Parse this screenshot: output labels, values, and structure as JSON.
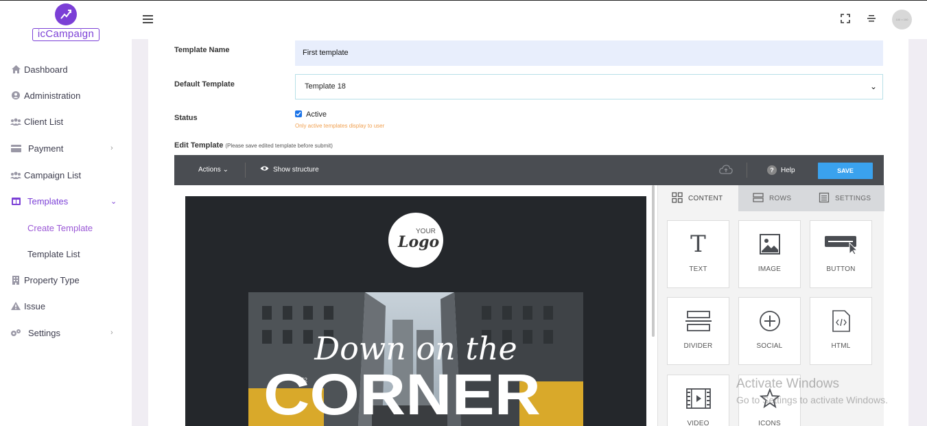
{
  "app": {
    "logo_text": "icCampaign"
  },
  "sidebar": {
    "items": [
      {
        "label": "Dashboard",
        "icon": "home-icon"
      },
      {
        "label": "Administration",
        "icon": "user-circle-icon"
      },
      {
        "label": "Client List",
        "icon": "users-icon"
      },
      {
        "label": "Payment",
        "icon": "card-icon",
        "chevron": "›"
      },
      {
        "label": "Campaign List",
        "icon": "users-icon"
      },
      {
        "label": "Templates",
        "icon": "columns-icon",
        "chevron": "⌄"
      },
      {
        "label": "Property Type",
        "icon": "building-icon"
      },
      {
        "label": "Issue",
        "icon": "warning-icon"
      },
      {
        "label": "Settings",
        "icon": "gears-icon",
        "chevron": "›"
      }
    ],
    "sub_items": [
      {
        "label": "Create Template"
      },
      {
        "label": "Template List"
      }
    ]
  },
  "header": {
    "avatar_text": "100 × 100"
  },
  "form": {
    "template_name_label": "Template Name",
    "template_name_value": "First template",
    "default_template_label": "Default Template",
    "default_template_value": "Template 18",
    "status_label": "Status",
    "active_label": "Active",
    "active_hint": "Only active templates display to user",
    "edit_template_label": "Edit Template",
    "edit_template_note": "(Please save edited template before submit)"
  },
  "editor": {
    "actions_label": "Actions",
    "show_structure_label": "Show structure",
    "help_label": "Help",
    "save_label": "SAVE",
    "tabs": [
      {
        "label": "CONTENT"
      },
      {
        "label": "ROWS"
      },
      {
        "label": "SETTINGS"
      }
    ],
    "blocks": [
      {
        "label": "TEXT"
      },
      {
        "label": "IMAGE"
      },
      {
        "label": "BUTTON"
      },
      {
        "label": "DIVIDER"
      },
      {
        "label": "SOCIAL"
      },
      {
        "label": "HTML"
      },
      {
        "label": "VIDEO"
      },
      {
        "label": "ICONS"
      }
    ],
    "email": {
      "logo_your": "YOUR",
      "logo_logo": "Logo",
      "hero_script": "Down on the",
      "hero_title": "CORNER",
      "taxi_text": "K72"
    }
  },
  "watermark": {
    "line1": "Activate Windows",
    "line2": "Go to Settings to activate Windows."
  },
  "colors": {
    "accent": "#7b3fd6",
    "save": "#3aa2ee",
    "toolbar": "#4a4d52"
  }
}
